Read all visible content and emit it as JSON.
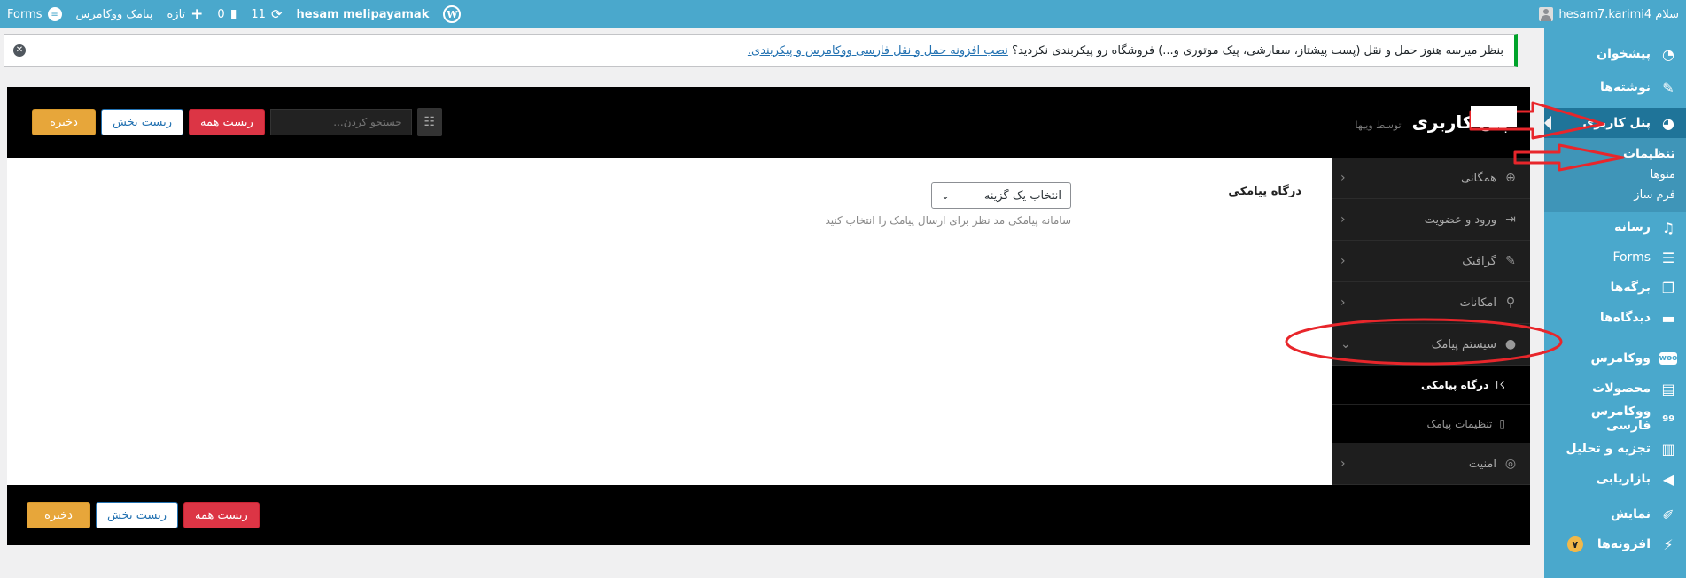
{
  "adminbar": {
    "site_name": "hesam melipayamak",
    "updates_count": "11",
    "comments_count": "0",
    "new_label": "تازه",
    "woo_sms_label": "پیامک ووکامرس",
    "forms_label": "Forms",
    "greeting": "سلام hesam7.karimi4"
  },
  "sidebar": {
    "items": [
      {
        "label": "پیشخوان",
        "icon": "dashboard-icon"
      },
      {
        "label": "نوشته‌ها",
        "icon": "pin-icon"
      },
      {
        "label": "پنل کاربری",
        "icon": "gauge-icon"
      },
      {
        "label": "رسانه",
        "icon": "media-icon"
      },
      {
        "label": "Forms",
        "icon": "forms-icon"
      },
      {
        "label": "برگه‌ها",
        "icon": "pages-icon"
      },
      {
        "label": "دیدگاه‌ها",
        "icon": "comments-icon"
      },
      {
        "label": "ووکامرس",
        "icon": "woo-icon"
      },
      {
        "label": "محصولات",
        "icon": "archive-icon"
      },
      {
        "label": "ووکامرس فارسی",
        "icon": "persian-woo-icon"
      },
      {
        "label": "تجزیه و تحلیل",
        "icon": "chart-icon"
      },
      {
        "label": "بازاریابی",
        "icon": "megaphone-icon"
      },
      {
        "label": "نمایش",
        "icon": "brush-icon"
      },
      {
        "label": "افزونه‌ها",
        "icon": "plugins-icon",
        "badge": "۷"
      }
    ],
    "submenu": {
      "settings": "تنظیمات",
      "menus": "منوها",
      "form_builder": "فرم ساز"
    }
  },
  "notice": {
    "text": "بنظر میرسه هنوز حمل و نقل (پست پیشتاز، سفارشی، پیک موتوری و...) فروشگاه رو پیکربندی نکردید؟",
    "link": "نصب افزونه حمل و نقل فارسی ووکامرس و پیکربندی."
  },
  "panel": {
    "title": "پنل کاربری",
    "by": "توسط ویپها",
    "search_placeholder": "جستجو کردن...",
    "reset_all": "ریست همه",
    "reset_section": "ریست بخش",
    "save": "ذخیره",
    "nav": {
      "general": "همگانی",
      "login": "ورود و عضویت",
      "graphic": "گرافیک",
      "features": "امکانات",
      "sms_system": "سیستم پیامک",
      "sms_gateway": "درگاه پیامکی",
      "sms_settings": "تنظیمات پیامک",
      "security": "امنیت"
    },
    "field": {
      "label": "درگاه پیامکی",
      "select_value": "انتخاب یک گزینه",
      "help": "سامانه پیامکی مد نظر برای ارسال پیامک را انتخاب کنید"
    }
  },
  "colors": {
    "sidebar_bg": "#4aa8cc",
    "accent_red": "#dc3545",
    "save_orange": "#e7a63a",
    "annotation_red": "#e8262b"
  }
}
